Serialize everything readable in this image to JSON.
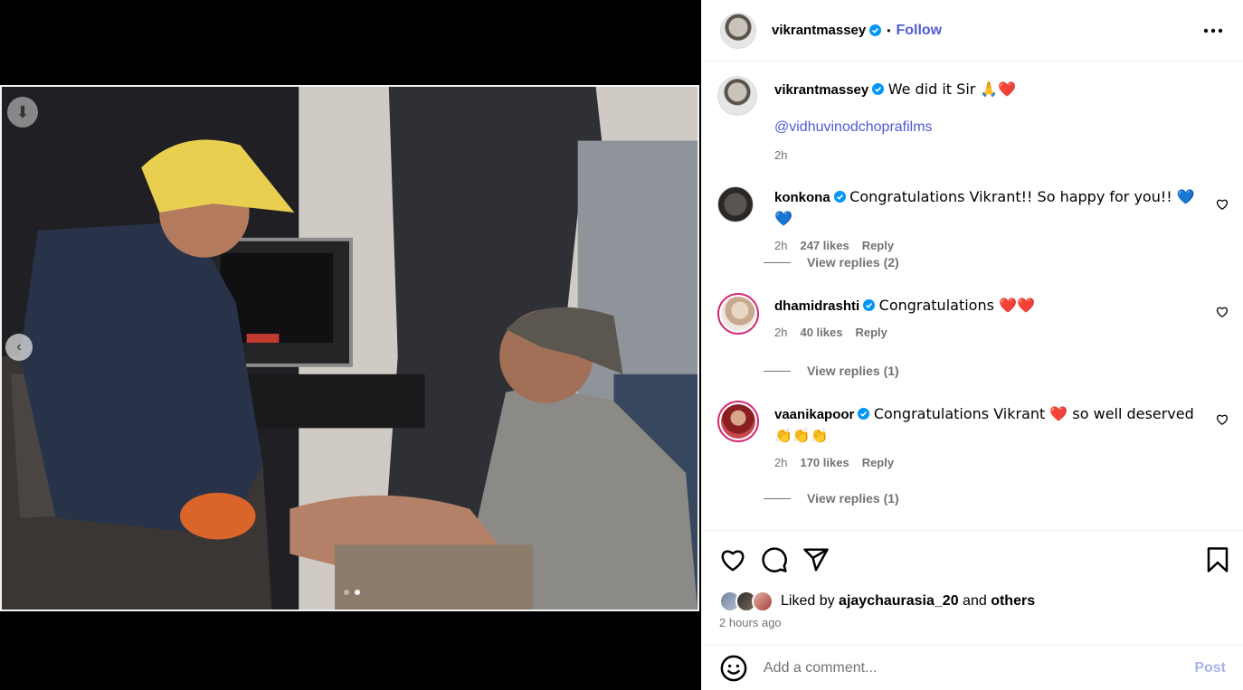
{
  "post_author": {
    "username": "vikrantmassey",
    "separator": "•",
    "follow_label": "Follow",
    "more_label": "..."
  },
  "caption": {
    "username": "vikrantmassey",
    "text": "We did it Sir 🙏❤️",
    "mention": "@vidhuvinodchoprafilms",
    "time": "2h"
  },
  "comments": [
    {
      "username": "konkona",
      "text": "Congratulations Vikrant!! So happy for you!! 💙💙",
      "time": "2h",
      "likes": "247 likes",
      "reply_label": "Reply",
      "view_replies": "View replies (2)"
    },
    {
      "username": "dhamidrashti",
      "text": "Congratulations ❤️❤️",
      "time": "2h",
      "likes": "40 likes",
      "reply_label": "Reply",
      "view_replies": "View replies (1)"
    },
    {
      "username": "vaanikapoor",
      "text": "Congratulations Vikrant ❤️ so well deserved 👏👏👏",
      "time": "2h",
      "likes": "170 likes",
      "reply_label": "Reply",
      "view_replies": "View replies (1)"
    }
  ],
  "liked_by": {
    "prefix": "Liked by",
    "user": "ajaychaurasia_20",
    "conjunction": "and",
    "others": "others"
  },
  "posted_time": "2 hours ago",
  "add_comment": {
    "placeholder": "Add a comment...",
    "post_label": "Post"
  },
  "carousel": {
    "slide_count": 2,
    "active_index": 1
  },
  "colors": {
    "accent": "#4f5bd5",
    "verified": "#0095f6",
    "muted": "#737373"
  }
}
